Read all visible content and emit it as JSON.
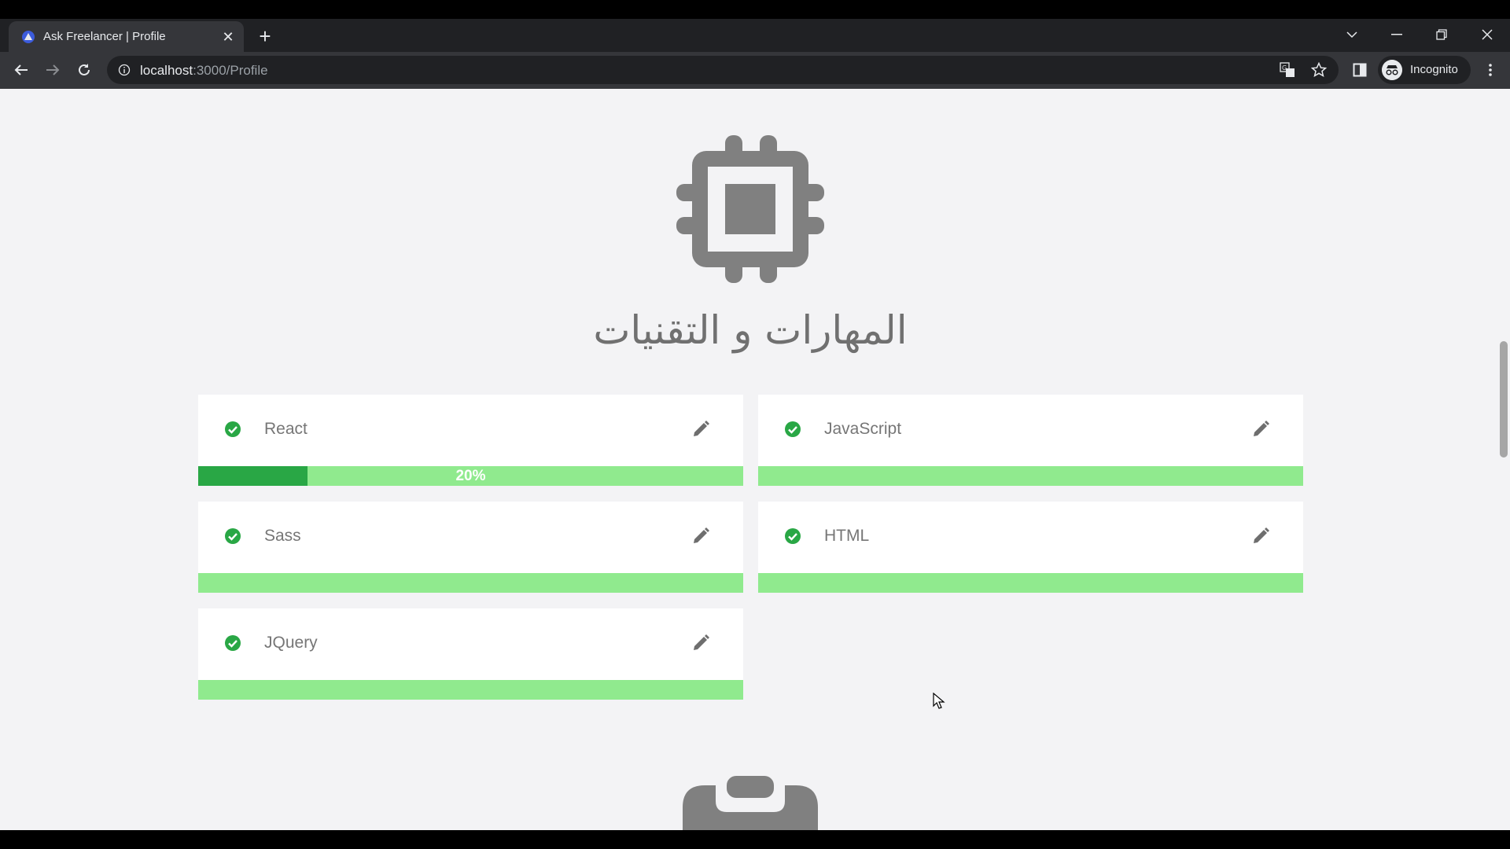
{
  "browser": {
    "tab_title": "Ask Freelancer | Profile",
    "url_host": "localhost",
    "url_path": ":3000/Profile",
    "profile_label": "Incognito"
  },
  "page": {
    "section_title": "المهارات و التقنيات",
    "skills": [
      {
        "name": "React",
        "progress_percent": 20,
        "progress_label": "20%"
      },
      {
        "name": "JavaScript",
        "progress_percent": 0,
        "progress_label": ""
      },
      {
        "name": "Sass",
        "progress_percent": 0,
        "progress_label": ""
      },
      {
        "name": "HTML",
        "progress_percent": 0,
        "progress_label": ""
      },
      {
        "name": "JQuery",
        "progress_percent": 0,
        "progress_label": ""
      }
    ]
  },
  "icons": {
    "section": "cpu-chip-icon",
    "skill_status": "check-circle-icon",
    "skill_action": "pencil-edit-icon",
    "next_section": "briefcase-icon"
  },
  "colors": {
    "page_bg": "#f3f3f5",
    "check_green": "#29a745",
    "bar_track": "#90ea8e",
    "bar_fill": "#29a745",
    "icon_gray": "#808080"
  }
}
